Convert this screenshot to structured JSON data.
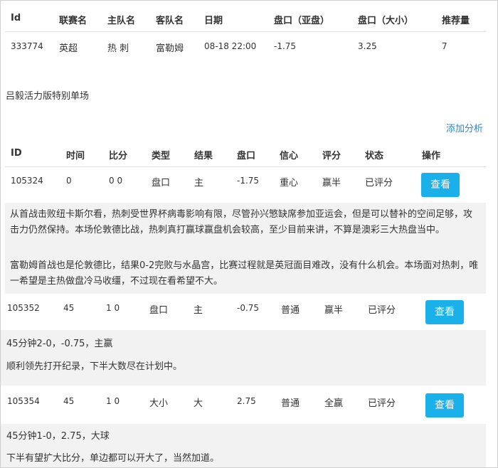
{
  "match_table": {
    "headers": [
      "Id",
      "联赛名",
      "主队名",
      "客队名",
      "日期",
      "盘口（亚盘）",
      "盘口（大小）",
      "推荐量"
    ],
    "row": [
      "333774",
      "英超",
      "热 刺",
      "富勒姆",
      "08-18 22:00",
      "-1.75",
      "3.25",
      "7"
    ]
  },
  "section_title": "吕毅活力版特别单场",
  "add_analysis_label": "添加分析",
  "analysis_table": {
    "headers": [
      "ID",
      "时间",
      "比分",
      "类型",
      "结果",
      "盘口",
      "信心",
      "评分",
      "状态",
      "操作"
    ]
  },
  "analyses": [
    {
      "cells": [
        "105324",
        "0",
        "0 0",
        "盘口",
        "主",
        "-1.75",
        "重心",
        "赢半",
        "已评分"
      ],
      "button": "查看",
      "paragraphs": [
        "从首战击败纽卡斯尔看，热刺受世界杯病毒影响有限，尽管孙兴慜缺席参加亚运会，但是可以替补的空间足够，攻击力仍然保持。本场伦敦德比战，热刺真打赢球赢盘机会较高，至少目前来讲，不算是澳彩三大热盘当中。",
        "富勒姆首战也是伦敦德比，结果0-2完败与水晶宫，比赛过程就是英冠面目难改，没有什么机会。本场面对热刺，唯一希望是主热做盘冷马收缰，不过现在看希望不大。"
      ]
    },
    {
      "cells": [
        "105352",
        "45",
        "1 0",
        "盘口",
        "主",
        "-0.75",
        "普通",
        "赢半",
        "已评分"
      ],
      "button": "查看",
      "paragraphs": [
        "45分钟2-0，-0.75，主赢",
        "顺利领先打开纪录，下半大数尽在计划中。"
      ]
    },
    {
      "cells": [
        "105354",
        "45",
        "1 0",
        "大小",
        "大",
        "2.75",
        "普通",
        "全赢",
        "已评分"
      ],
      "button": "查看",
      "paragraphs": [
        "45分钟1-0，2.75，大球",
        "下半有望扩大比分，单边都可以开大了，当然加道。"
      ]
    }
  ],
  "colors": {
    "button": "#1ab0ea",
    "link": "#2e88c8",
    "grey_panel": "#f2f2f2"
  }
}
